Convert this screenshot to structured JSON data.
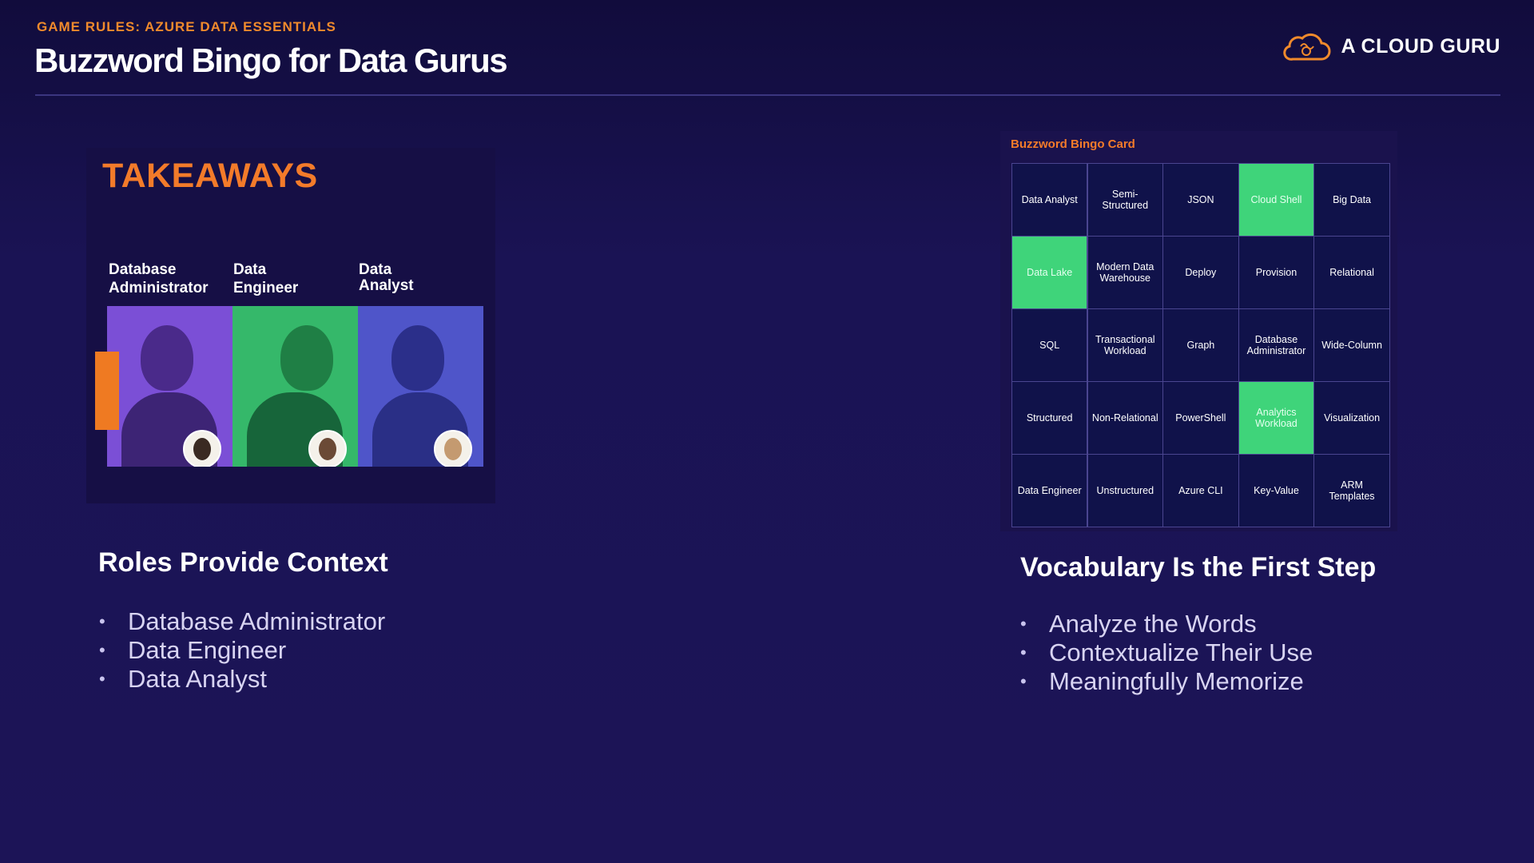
{
  "header": {
    "eyebrow": "GAME RULES: AZURE DATA ESSENTIALS",
    "title": "Buzzword Bingo for Data Gurus",
    "brand": "A CLOUD GURU"
  },
  "left": {
    "takeaways": "TAKEAWAYS",
    "roles": [
      {
        "label_line1": "Database",
        "label_line2": "Administrator",
        "tint": "#7b4fd6"
      },
      {
        "label_line1": "Data",
        "label_line2": "Engineer",
        "tint": "#35b86a"
      },
      {
        "label_line1": "Data",
        "label_line2": "Analyst",
        "tint": "#4f55c9"
      }
    ],
    "section_title": "Roles Provide Context",
    "bullets": [
      "Database Administrator",
      "Data Engineer",
      "Data Analyst"
    ]
  },
  "right": {
    "card_title": "Buzzword Bingo Card",
    "cells": [
      {
        "label": "Data Analyst",
        "marked": false
      },
      {
        "label": "Semi-\nStructured",
        "marked": false
      },
      {
        "label": "JSON",
        "marked": false
      },
      {
        "label": "Cloud Shell",
        "marked": true
      },
      {
        "label": "Big Data",
        "marked": false
      },
      {
        "label": "Data Lake",
        "marked": true
      },
      {
        "label": "Modern Data\nWarehouse",
        "marked": false
      },
      {
        "label": "Deploy",
        "marked": false
      },
      {
        "label": "Provision",
        "marked": false
      },
      {
        "label": "Relational",
        "marked": false
      },
      {
        "label": "SQL",
        "marked": false
      },
      {
        "label": "Transactional\nWorkload",
        "marked": false
      },
      {
        "label": "Graph",
        "marked": false
      },
      {
        "label": "Database\nAdministrator",
        "marked": false
      },
      {
        "label": "Wide-Column",
        "marked": false
      },
      {
        "label": "Structured",
        "marked": false
      },
      {
        "label": "Non-Relational",
        "marked": false
      },
      {
        "label": "PowerShell",
        "marked": false
      },
      {
        "label": "Analytics\nWorkload",
        "marked": true
      },
      {
        "label": "Visualization",
        "marked": false
      },
      {
        "label": "Data Engineer",
        "marked": false
      },
      {
        "label": "Unstructured",
        "marked": false
      },
      {
        "label": "Azure CLI",
        "marked": false
      },
      {
        "label": "Key-Value",
        "marked": false
      },
      {
        "label": "ARM\nTemplates",
        "marked": false
      }
    ],
    "section_title": "Vocabulary Is the First Step",
    "bullets": [
      "Analyze the Words",
      "Contextualize Their Use",
      "Meaningfully Memorize"
    ]
  },
  "colors": {
    "accent_orange": "#f37b2a",
    "marked_green": "#3fd47a",
    "background": "#1a1354"
  },
  "icons": {
    "brand_logo": "cloud-brain-icon",
    "bullet": "bullet-dot-icon"
  }
}
